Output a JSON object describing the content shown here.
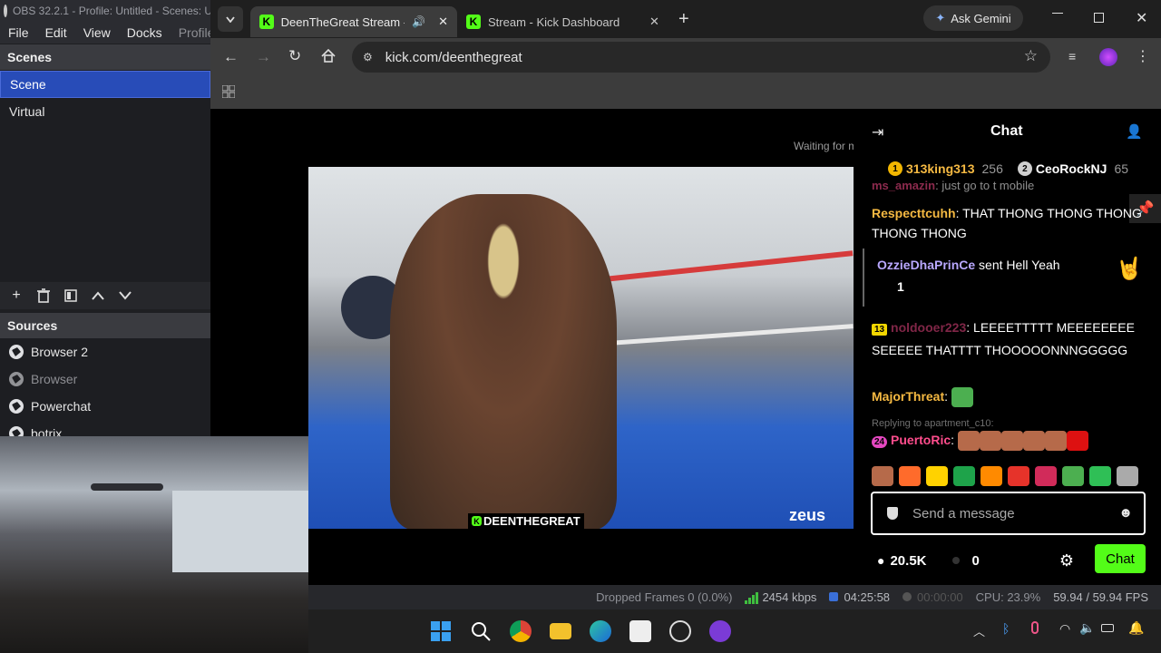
{
  "obs": {
    "title": "OBS 32.2.1 - Profile: Untitled - Scenes: U",
    "menu": [
      "File",
      "Edit",
      "View",
      "Docks",
      "Profile"
    ],
    "scenes_header": "Scenes",
    "scenes": [
      "Scene",
      "Virtual"
    ],
    "sources_header": "Sources",
    "sources": [
      "Browser 2",
      "Browser",
      "Powerchat",
      "botrix"
    ],
    "status": {
      "dropped": "Dropped Frames 0 (0.0%)",
      "bitrate": "2454 kbps",
      "live_time": "04:25:58",
      "rec_time": "00:00:00",
      "cpu": "CPU: 23.9%",
      "fps": "59.94 / 59.94 FPS"
    }
  },
  "browser": {
    "tabs": [
      {
        "label": "DeenTheGreat Stream - We",
        "active": true
      },
      {
        "label": "Stream - Kick Dashboard",
        "active": false
      }
    ],
    "new_tab": "+",
    "ask_gemini": "Ask Gemini",
    "url": "kick.com/deenthegreat"
  },
  "stream": {
    "waiting": "Waiting for messages...",
    "streamer_tag": "DEENTHEGREAT",
    "sponsor_text": "zeus"
  },
  "chat": {
    "title": "Chat",
    "leaderboard": [
      {
        "rank": "1",
        "name": "313king313",
        "score": "256"
      },
      {
        "rank": "2",
        "name": "CeoRockNJ",
        "score": "65"
      }
    ],
    "messages": [
      {
        "user": "ms_amazin",
        "text": "just go to t mobile"
      },
      {
        "user": "Respecttcuhh",
        "text": "THAT THONG THONG THONG THONG THONG"
      },
      {
        "user": "OzzieDhaPrinCe",
        "text": "sent Hell Yeah",
        "count": "1"
      },
      {
        "badge": "13",
        "user": "noldooer223",
        "text": "LEEEETTTTT MEEEEEEEE SEEEEE THATTTT THOOOOONNNGGGGG"
      },
      {
        "user": "MajorThreat",
        "text": ""
      },
      {
        "reply": "Replying to apartment_c10:"
      },
      {
        "badge": "24",
        "user": "PuertoRic",
        "text": ""
      }
    ],
    "input_placeholder": "Send a message",
    "viewers": "20.5K",
    "count_two": "0",
    "send_label": "Chat",
    "colors": {
      "accent": "#53fc18",
      "user_orange": "#f5b942",
      "user_purple": "#b9a8ff",
      "user_pink": "#ff4d8d"
    }
  },
  "icons": [
    "search-icon",
    "chrome-icon",
    "folder-icon",
    "edge-icon",
    "store-icon",
    "obs-icon",
    "twitch-icon",
    "bluetooth-icon",
    "mic-icon",
    "wifi-icon",
    "volume-icon",
    "battery-icon",
    "bell-icon"
  ]
}
